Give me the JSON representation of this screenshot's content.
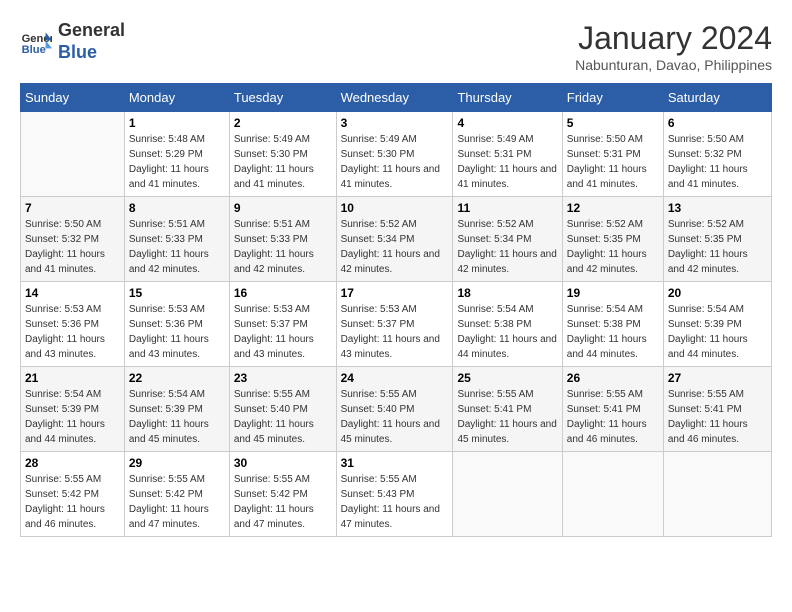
{
  "header": {
    "logo_line1": "General",
    "logo_line2": "Blue",
    "month": "January 2024",
    "location": "Nabunturan, Davao, Philippines"
  },
  "weekdays": [
    "Sunday",
    "Monday",
    "Tuesday",
    "Wednesday",
    "Thursday",
    "Friday",
    "Saturday"
  ],
  "weeks": [
    [
      {
        "day": "",
        "sunrise": "",
        "sunset": "",
        "daylight": ""
      },
      {
        "day": "1",
        "sunrise": "Sunrise: 5:48 AM",
        "sunset": "Sunset: 5:29 PM",
        "daylight": "Daylight: 11 hours and 41 minutes."
      },
      {
        "day": "2",
        "sunrise": "Sunrise: 5:49 AM",
        "sunset": "Sunset: 5:30 PM",
        "daylight": "Daylight: 11 hours and 41 minutes."
      },
      {
        "day": "3",
        "sunrise": "Sunrise: 5:49 AM",
        "sunset": "Sunset: 5:30 PM",
        "daylight": "Daylight: 11 hours and 41 minutes."
      },
      {
        "day": "4",
        "sunrise": "Sunrise: 5:49 AM",
        "sunset": "Sunset: 5:31 PM",
        "daylight": "Daylight: 11 hours and 41 minutes."
      },
      {
        "day": "5",
        "sunrise": "Sunrise: 5:50 AM",
        "sunset": "Sunset: 5:31 PM",
        "daylight": "Daylight: 11 hours and 41 minutes."
      },
      {
        "day": "6",
        "sunrise": "Sunrise: 5:50 AM",
        "sunset": "Sunset: 5:32 PM",
        "daylight": "Daylight: 11 hours and 41 minutes."
      }
    ],
    [
      {
        "day": "7",
        "sunrise": "Sunrise: 5:50 AM",
        "sunset": "Sunset: 5:32 PM",
        "daylight": "Daylight: 11 hours and 41 minutes."
      },
      {
        "day": "8",
        "sunrise": "Sunrise: 5:51 AM",
        "sunset": "Sunset: 5:33 PM",
        "daylight": "Daylight: 11 hours and 42 minutes."
      },
      {
        "day": "9",
        "sunrise": "Sunrise: 5:51 AM",
        "sunset": "Sunset: 5:33 PM",
        "daylight": "Daylight: 11 hours and 42 minutes."
      },
      {
        "day": "10",
        "sunrise": "Sunrise: 5:52 AM",
        "sunset": "Sunset: 5:34 PM",
        "daylight": "Daylight: 11 hours and 42 minutes."
      },
      {
        "day": "11",
        "sunrise": "Sunrise: 5:52 AM",
        "sunset": "Sunset: 5:34 PM",
        "daylight": "Daylight: 11 hours and 42 minutes."
      },
      {
        "day": "12",
        "sunrise": "Sunrise: 5:52 AM",
        "sunset": "Sunset: 5:35 PM",
        "daylight": "Daylight: 11 hours and 42 minutes."
      },
      {
        "day": "13",
        "sunrise": "Sunrise: 5:52 AM",
        "sunset": "Sunset: 5:35 PM",
        "daylight": "Daylight: 11 hours and 42 minutes."
      }
    ],
    [
      {
        "day": "14",
        "sunrise": "Sunrise: 5:53 AM",
        "sunset": "Sunset: 5:36 PM",
        "daylight": "Daylight: 11 hours and 43 minutes."
      },
      {
        "day": "15",
        "sunrise": "Sunrise: 5:53 AM",
        "sunset": "Sunset: 5:36 PM",
        "daylight": "Daylight: 11 hours and 43 minutes."
      },
      {
        "day": "16",
        "sunrise": "Sunrise: 5:53 AM",
        "sunset": "Sunset: 5:37 PM",
        "daylight": "Daylight: 11 hours and 43 minutes."
      },
      {
        "day": "17",
        "sunrise": "Sunrise: 5:53 AM",
        "sunset": "Sunset: 5:37 PM",
        "daylight": "Daylight: 11 hours and 43 minutes."
      },
      {
        "day": "18",
        "sunrise": "Sunrise: 5:54 AM",
        "sunset": "Sunset: 5:38 PM",
        "daylight": "Daylight: 11 hours and 44 minutes."
      },
      {
        "day": "19",
        "sunrise": "Sunrise: 5:54 AM",
        "sunset": "Sunset: 5:38 PM",
        "daylight": "Daylight: 11 hours and 44 minutes."
      },
      {
        "day": "20",
        "sunrise": "Sunrise: 5:54 AM",
        "sunset": "Sunset: 5:39 PM",
        "daylight": "Daylight: 11 hours and 44 minutes."
      }
    ],
    [
      {
        "day": "21",
        "sunrise": "Sunrise: 5:54 AM",
        "sunset": "Sunset: 5:39 PM",
        "daylight": "Daylight: 11 hours and 44 minutes."
      },
      {
        "day": "22",
        "sunrise": "Sunrise: 5:54 AM",
        "sunset": "Sunset: 5:39 PM",
        "daylight": "Daylight: 11 hours and 45 minutes."
      },
      {
        "day": "23",
        "sunrise": "Sunrise: 5:55 AM",
        "sunset": "Sunset: 5:40 PM",
        "daylight": "Daylight: 11 hours and 45 minutes."
      },
      {
        "day": "24",
        "sunrise": "Sunrise: 5:55 AM",
        "sunset": "Sunset: 5:40 PM",
        "daylight": "Daylight: 11 hours and 45 minutes."
      },
      {
        "day": "25",
        "sunrise": "Sunrise: 5:55 AM",
        "sunset": "Sunset: 5:41 PM",
        "daylight": "Daylight: 11 hours and 45 minutes."
      },
      {
        "day": "26",
        "sunrise": "Sunrise: 5:55 AM",
        "sunset": "Sunset: 5:41 PM",
        "daylight": "Daylight: 11 hours and 46 minutes."
      },
      {
        "day": "27",
        "sunrise": "Sunrise: 5:55 AM",
        "sunset": "Sunset: 5:41 PM",
        "daylight": "Daylight: 11 hours and 46 minutes."
      }
    ],
    [
      {
        "day": "28",
        "sunrise": "Sunrise: 5:55 AM",
        "sunset": "Sunset: 5:42 PM",
        "daylight": "Daylight: 11 hours and 46 minutes."
      },
      {
        "day": "29",
        "sunrise": "Sunrise: 5:55 AM",
        "sunset": "Sunset: 5:42 PM",
        "daylight": "Daylight: 11 hours and 47 minutes."
      },
      {
        "day": "30",
        "sunrise": "Sunrise: 5:55 AM",
        "sunset": "Sunset: 5:42 PM",
        "daylight": "Daylight: 11 hours and 47 minutes."
      },
      {
        "day": "31",
        "sunrise": "Sunrise: 5:55 AM",
        "sunset": "Sunset: 5:43 PM",
        "daylight": "Daylight: 11 hours and 47 minutes."
      },
      {
        "day": "",
        "sunrise": "",
        "sunset": "",
        "daylight": ""
      },
      {
        "day": "",
        "sunrise": "",
        "sunset": "",
        "daylight": ""
      },
      {
        "day": "",
        "sunrise": "",
        "sunset": "",
        "daylight": ""
      }
    ]
  ]
}
